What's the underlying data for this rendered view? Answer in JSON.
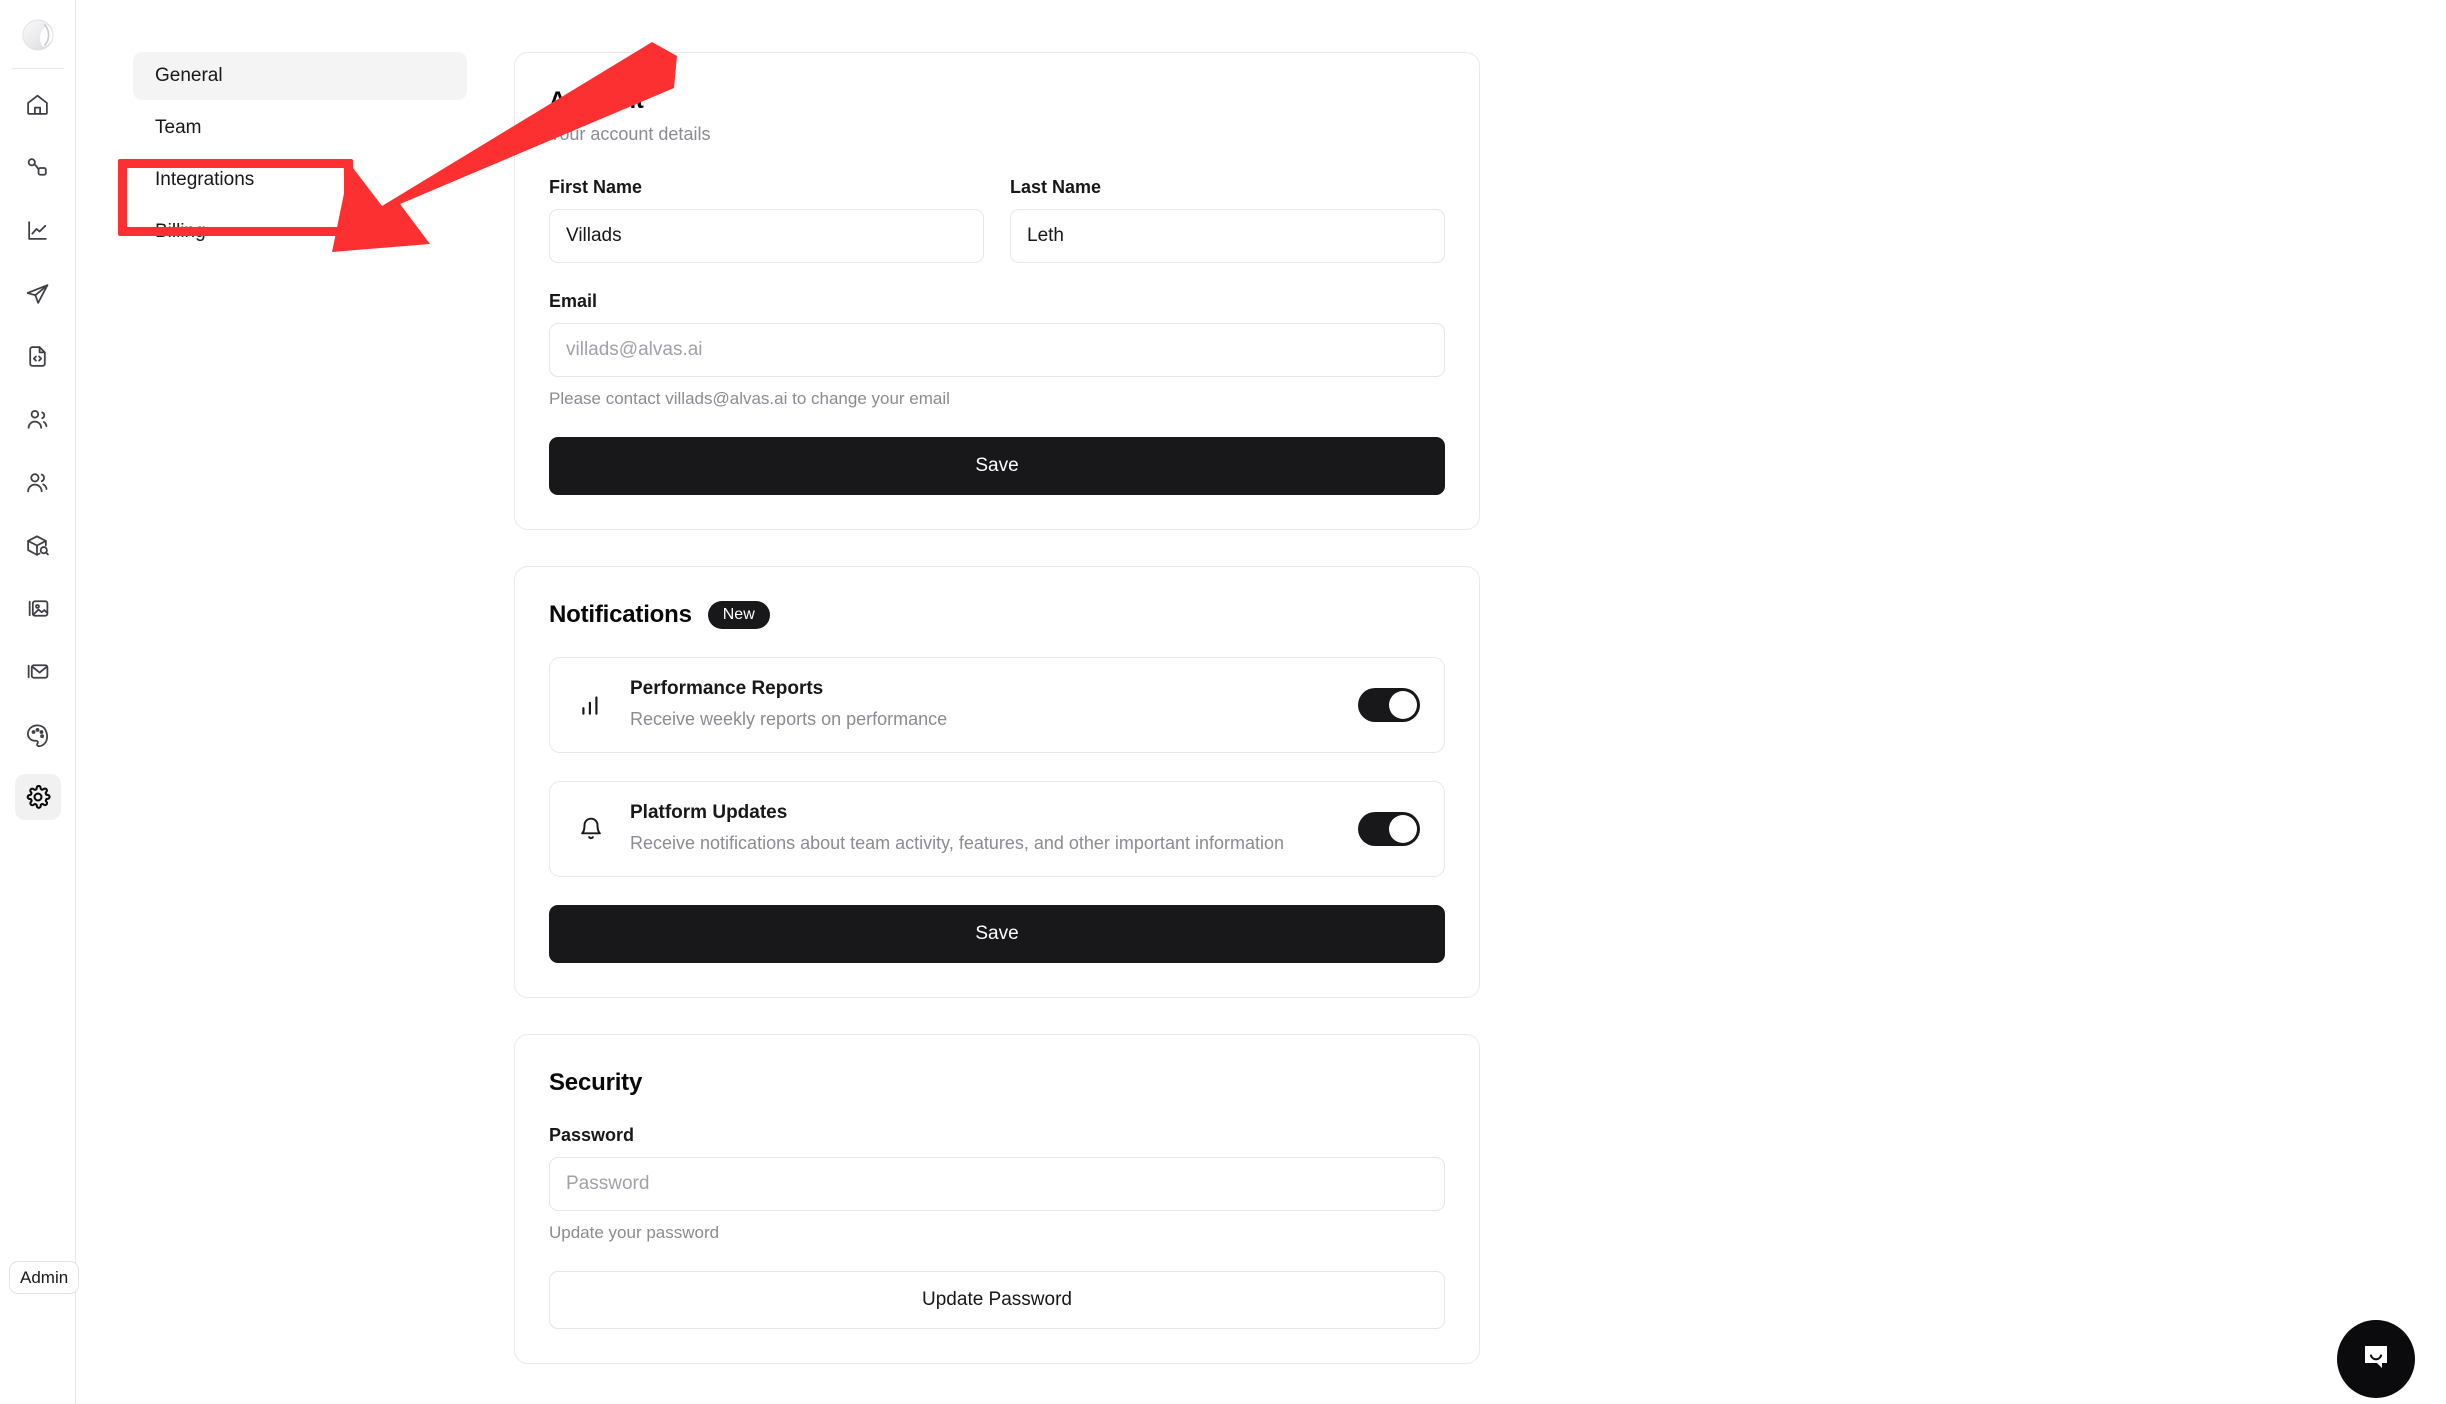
{
  "rail": {
    "logo_name": "app-logo",
    "items": [
      {
        "name": "home-icon",
        "label": "Home"
      },
      {
        "name": "workflow-icon",
        "label": "Workflows"
      },
      {
        "name": "analytics-icon",
        "label": "Analytics"
      },
      {
        "name": "send-icon",
        "label": "Campaigns"
      },
      {
        "name": "code-file-icon",
        "label": "Scripts"
      },
      {
        "name": "contacts-icon",
        "label": "Contacts"
      },
      {
        "name": "users-icon",
        "label": "Audience"
      },
      {
        "name": "package-search-icon",
        "label": "Products"
      },
      {
        "name": "image-icon",
        "label": "Media"
      },
      {
        "name": "inbox-icon",
        "label": "Inbox"
      },
      {
        "name": "palette-icon",
        "label": "Branding"
      },
      {
        "name": "settings-gear-icon",
        "label": "Settings"
      }
    ],
    "admin_badge": "Admin"
  },
  "subnav": {
    "items": [
      {
        "label": "General",
        "active": true
      },
      {
        "label": "Team",
        "active": false
      },
      {
        "label": "Integrations",
        "active": false
      },
      {
        "label": "Billing",
        "active": false
      }
    ]
  },
  "account": {
    "title": "Account",
    "subtitle": "Your account details",
    "first_name_label": "First Name",
    "first_name_value": "Villads",
    "last_name_label": "Last Name",
    "last_name_value": "Leth",
    "email_label": "Email",
    "email_placeholder": "villads@alvas.ai",
    "email_help": "Please contact villads@alvas.ai to change your email",
    "save_label": "Save"
  },
  "notifications": {
    "title": "Notifications",
    "badge": "New",
    "items": [
      {
        "icon": "bar-chart-icon",
        "title": "Performance Reports",
        "desc": "Receive weekly reports on performance",
        "enabled": true
      },
      {
        "icon": "bell-icon",
        "title": "Platform Updates",
        "desc": "Receive notifications about team activity, features, and other important information",
        "enabled": true
      }
    ],
    "save_label": "Save"
  },
  "security": {
    "title": "Security",
    "password_label": "Password",
    "password_placeholder": "Password",
    "password_help": "Update your password",
    "update_label": "Update Password"
  },
  "annotations": {
    "highlight_color": "#fc3030",
    "arrow_color": "#fc3030",
    "target": "Integrations"
  },
  "chat": {
    "icon": "chat-bubble-icon"
  }
}
